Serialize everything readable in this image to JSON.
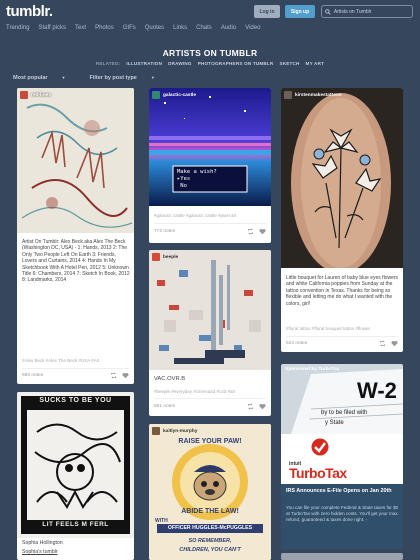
{
  "header": {
    "logo": "tumblr.",
    "login_label": "Log in",
    "signup_label": "Sign up",
    "search_placeholder": "Artists on Tumblr"
  },
  "nav": [
    "Trending",
    "Staff picks",
    "Text",
    "Photos",
    "GIFs",
    "Quotes",
    "Links",
    "Chats",
    "Audio",
    "Video"
  ],
  "page": {
    "title": "ARTISTS ON TUMBLR",
    "related_label": "RELATED:",
    "related": [
      "ILLUSTRATION",
      "DRAWING",
      "PHOTOGRAPHERS ON TUMBLR",
      "SKETCH",
      "MY ART"
    ],
    "filter_popular": "Most popular",
    "filter_type": "Filter by post type"
  },
  "posts": {
    "p1": {
      "author": "red-lines",
      "text": "Artist On Tumblr:    Alex Beck.aka Alex The Beck (Washington DC, USA) - 1: Hands, 2013  2: The Only Two People Left On Earth  3: Friends, Lovers and Curtains, 2014  4: Hands In My Sketchbook With A Hotel Pen, 2012  5: Unknown Title  6: Chambers, 2014  7: Sketch In Book, 2012  8: Landmarks, 2014",
      "tags": "#Alex Beck   #Alex The Beck   #USA   #Art",
      "notes": "686 notes"
    },
    "p2": {
      "author": "galactic-castle",
      "dialog_title": "Make a wish?",
      "dialog_yes": "▸Yes",
      "dialog_no": " No",
      "tags": "#galactic castle   #galactic castle   #pixel art",
      "notes": "772 notes"
    },
    "p3": {
      "author": "kirstenmakestattoos",
      "text": "Little bouquet for Lauren of baby blue eyes flowers and white California poppies from Sunday at the tattoo convention in Texas. Thanks for being so flexible and letting me do what I wanted with the colors, girl!",
      "tags": "#floral tattoo   #floral bouquet tattoo   #flower",
      "notes": "524 notes"
    },
    "p4": {
      "author": "beeple",
      "caption": "VAC.OVR.B",
      "tags": "#beeple   #everyday   #cinema4d   #c4d   #art",
      "notes": "561 notes"
    },
    "p5": {
      "sponsor": "Sponsored by TurboTax",
      "form_w": "W-2",
      "form_line1": "by to be filed with",
      "form_line2": "y State",
      "brand_small": "intuit",
      "brand": "TurboTax",
      "headline": "IRS Announces E-File Opens on Jan 20th",
      "text": "You can file your complete Federal & State taxes for $0 at TurboTax with zero hidden costs. You'll get your max refund, guaranteed & taxes done right. ◦"
    },
    "p6": {
      "banner": "SUCKS TO BE YOU",
      "caption_author": "Sophia Hollington",
      "caption_link": "Sophia's tumblr",
      "footer_word": "LIT FEELS M FERL"
    },
    "p7": {
      "author": "kaitlyn-murphy",
      "arc_top": "RAISE YOUR PAW!",
      "arc_mid": "ABIDE THE LAW!",
      "with_word": "WITH",
      "officer": "OFFICER HUGGLES-McPUGGLES",
      "remember": "SO REMEMBER,",
      "children": "CHILDREN, YOU CAN'T"
    }
  },
  "colors": {
    "background": "#36465d",
    "signup": "#529ecc",
    "login": "#a0aec0",
    "turbotax_red": "#d52b1e",
    "sponsored_bg": "#2f4f6b"
  }
}
